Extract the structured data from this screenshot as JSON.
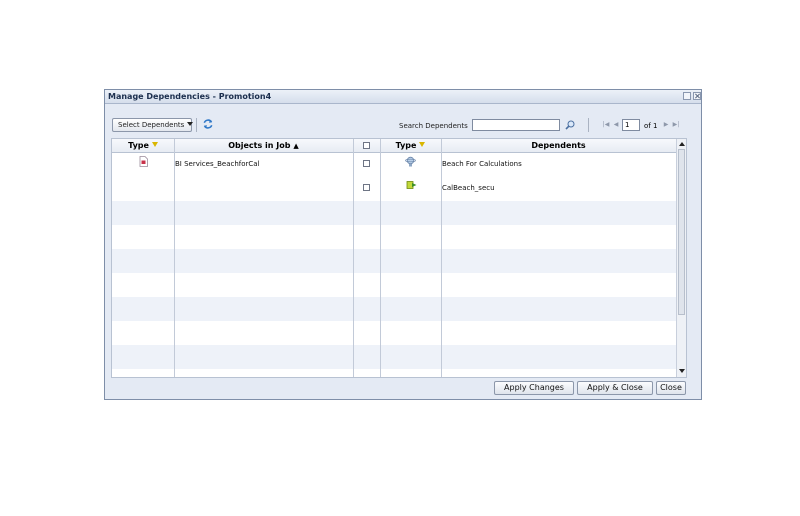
{
  "dialog": {
    "title": "Manage Dependencies - Promotion4"
  },
  "toolbar": {
    "select_dependents_label": "Select Dependents",
    "search_label": "Search Dependents",
    "search_value": "",
    "page_value": "1",
    "page_of_label": "of 1"
  },
  "grid": {
    "headers": {
      "type_left": "Type",
      "objects_in_job": "Objects in Job",
      "type_right": "Type",
      "dependents": "Dependents"
    },
    "rows": [
      {
        "object": "BI Services_BeachforCal",
        "dependent": "Beach For Calculations",
        "object_icon": "document-icon",
        "dependent_icon": "universe-icon"
      },
      {
        "object": "",
        "dependent": "CalBeach_secu",
        "object_icon": "",
        "dependent_icon": "security-object-icon"
      }
    ]
  },
  "buttons": {
    "apply_changes": "Apply Changes",
    "apply_close": "Apply & Close",
    "close": "Close"
  },
  "colors": {
    "title_text": "#1c2f4e",
    "dialog_bg": "#e4eaf4",
    "row_alt": "#eef2f9",
    "filter_icon": "#d9b600"
  }
}
